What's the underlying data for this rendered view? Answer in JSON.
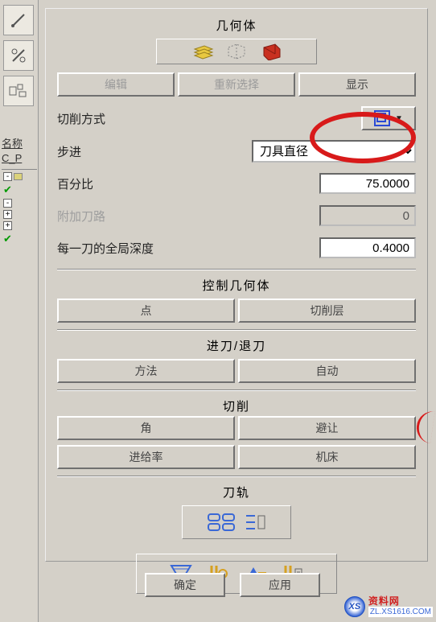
{
  "left": {
    "tree_header1": "名称",
    "tree_header2": "C_P"
  },
  "geometry": {
    "title": "几何体",
    "btn_edit": "编辑",
    "btn_reselect": "重新选择",
    "btn_display": "显示"
  },
  "params": {
    "cut_method_label": "切削方式",
    "step_label": "步进",
    "tool_diameter": "刀具直径",
    "percent_label": "百分比",
    "percent_value": "75.0000",
    "add_tool_label": "附加刀路",
    "add_tool_value": "0",
    "global_depth_label": "每一刀的全局深度",
    "global_depth_value": "0.4000"
  },
  "control_geo": {
    "title": "控制几何体",
    "btn_point": "点",
    "btn_cutlayer": "切削层"
  },
  "in_out": {
    "title": "进刀/退刀",
    "btn_method": "方法",
    "btn_auto": "自动"
  },
  "cutting": {
    "title": "切削",
    "btn_corner": "角",
    "btn_avoid": "避让",
    "btn_feedrate": "进给率",
    "btn_machine": "机床"
  },
  "toolpath": {
    "title": "刀轨"
  },
  "footer": {
    "ok": "确定",
    "apply": "应用"
  },
  "watermark": {
    "logo": "XS",
    "top": "资料网",
    "bot": "ZL.XS1616.COM"
  }
}
